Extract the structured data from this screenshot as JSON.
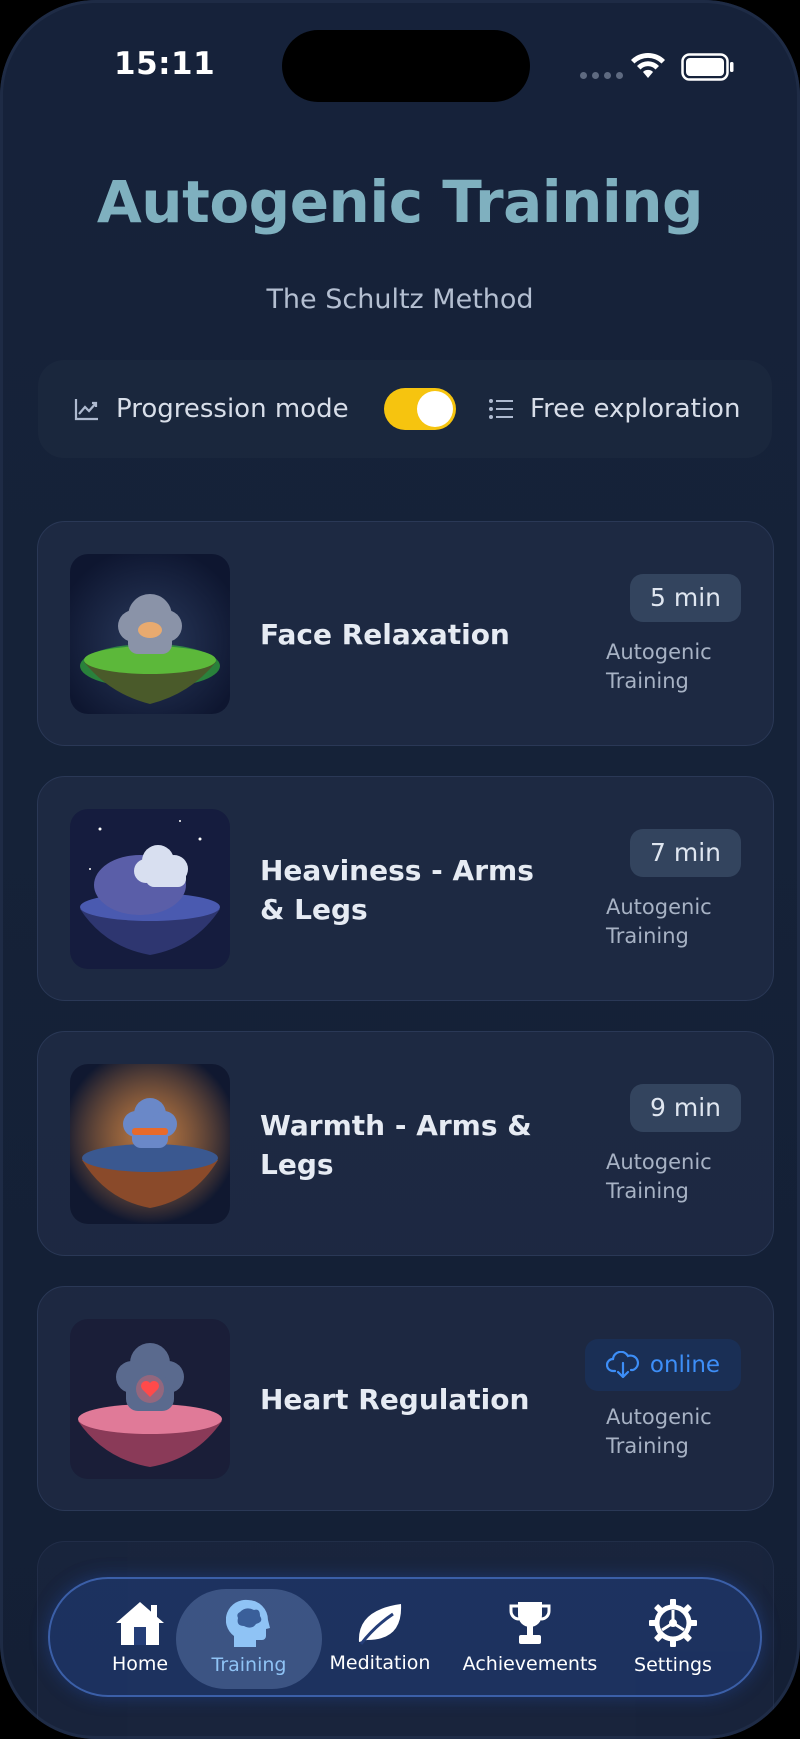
{
  "status_bar": {
    "time": "15:11"
  },
  "header": {
    "title": "Autogenic Training",
    "subtitle": "The Schultz Method"
  },
  "mode_switch": {
    "left_label": "Progression mode",
    "right_label": "Free exploration",
    "toggle_on": true
  },
  "sessions": [
    {
      "title": "Face Relaxation",
      "badge": "5 min",
      "category": "Autogenic Training",
      "image": "cloud-meditating-green-island"
    },
    {
      "title": "Heaviness - Arms & Legs",
      "badge": "7 min",
      "category": "Autogenic Training",
      "image": "cloud-resting-on-boulder"
    },
    {
      "title": "Warmth - Arms & Legs",
      "badge": "9 min",
      "category": "Autogenic Training",
      "image": "cloud-with-scarf-glowing"
    },
    {
      "title": "Heart Regulation",
      "badge": "online",
      "category": "Autogenic Training",
      "image": "cloud-with-heart-pink-island"
    }
  ],
  "tabbar": {
    "tabs": [
      {
        "label": "Home",
        "icon": "home-icon"
      },
      {
        "label": "Training",
        "icon": "brain-head-icon",
        "active": true
      },
      {
        "label": "Meditation",
        "icon": "leaf-icon"
      },
      {
        "label": "Achievements",
        "icon": "trophy-icon"
      },
      {
        "label": "Settings",
        "icon": "gear-icon"
      }
    ]
  },
  "colors": {
    "background": "#152238",
    "title": "#7fb0bf",
    "toggle": "#f6c40f",
    "online": "#3d8ef7",
    "active_tab": "#8fc3f5"
  }
}
